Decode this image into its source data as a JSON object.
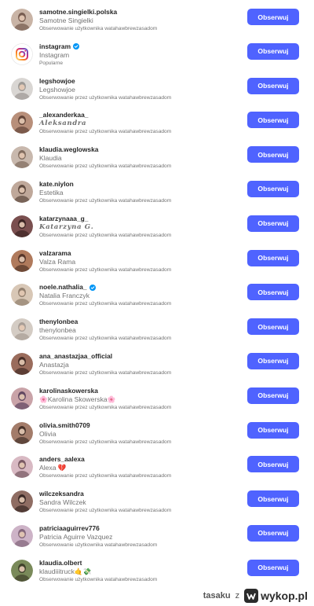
{
  "follow_label": "Obserwuj",
  "accent_color": "#4f63ff",
  "accounts": [
    {
      "username": "samotne.singielki.polska",
      "verified": false,
      "full_name": "Samotne Singielki",
      "subtitle": "Obserwowanie użytkownika watahawbrewzasadom",
      "avatar": "profile-photo"
    },
    {
      "username": "instagram",
      "verified": true,
      "full_name": "Instagram",
      "subtitle": "Popularne",
      "avatar": "instagram-logo"
    },
    {
      "username": "legshowjoe",
      "verified": false,
      "full_name": "Legshowjoe",
      "subtitle": "Obserwowanie przez użytkownika watahawbrewzasadom",
      "avatar": "profile-photo"
    },
    {
      "username": "_alexanderkaa_",
      "verified": false,
      "full_name": "𝑨𝒍𝒆𝒌𝒔𝒂𝒏𝒅𝒓𝒂",
      "subtitle": "Obserwowanie przez użytkownika watahawbrewzasadom",
      "avatar": "profile-photo",
      "script": true
    },
    {
      "username": "klaudia.weglowska",
      "verified": false,
      "full_name": "Klaudia",
      "subtitle": "Obserwowanie przez użytkownika watahawbrewzasadom",
      "avatar": "profile-photo"
    },
    {
      "username": "kate.niylon",
      "verified": false,
      "full_name": "Estetika",
      "subtitle": "Obserwowanie przez użytkownika watahawbrewzasadom",
      "avatar": "profile-photo"
    },
    {
      "username": "katarzynaaa_g_",
      "verified": false,
      "full_name": "𝑲𝒂𝒕𝒂𝒓𝒛𝒚𝒏𝒂 𝑮.",
      "subtitle": "Obserwowanie przez użytkownika watahawbrewzasadom",
      "avatar": "profile-photo",
      "script": true
    },
    {
      "username": "valzarama",
      "verified": false,
      "full_name": "Valza Rama",
      "subtitle": "Obserwowanie przez użytkownika watahawbrewzasadom",
      "avatar": "profile-photo"
    },
    {
      "username": "noele.nathalia_",
      "verified": true,
      "full_name": "Natalia Franczyk",
      "subtitle": "Obserwowanie przez użytkownika watahawbrewzasadom",
      "avatar": "profile-photo"
    },
    {
      "username": "thenylonbea",
      "verified": false,
      "full_name": "thenylonbea",
      "subtitle": "Obserwowanie przez użytkownika watahawbrewzasadom",
      "avatar": "profile-photo"
    },
    {
      "username": "ana_anastazjaa_official",
      "verified": false,
      "full_name": "Anastazja",
      "subtitle": "Obserwowanie przez użytkownika watahawbrewzasadom",
      "avatar": "profile-photo"
    },
    {
      "username": "karolinaskowerska",
      "verified": false,
      "full_name": "🌸Karolina Skowerska🌸",
      "subtitle": "Obserwowanie przez użytkownika watahawbrewzasadom",
      "avatar": "profile-photo"
    },
    {
      "username": "olivia.smith0709",
      "verified": false,
      "full_name": "Olivia",
      "subtitle": "Obserwowanie przez użytkownika watahawbrewzasadom",
      "avatar": "profile-photo"
    },
    {
      "username": "anders_aalexa",
      "verified": false,
      "full_name": "Alexa 💔",
      "subtitle": "Obserwowanie przez użytkownika watahawbrewzasadom",
      "avatar": "profile-photo"
    },
    {
      "username": "wilczeksandra",
      "verified": false,
      "full_name": "Sandra Wilczek",
      "subtitle": "Obserwowanie przez użytkownika watahawbrewzasadom",
      "avatar": "profile-photo"
    },
    {
      "username": "patriciaaguirrev776",
      "verified": false,
      "full_name": "Patricia Aguirre Vazquez",
      "subtitle": "Obserwowanie użytkownika watahawbrewzasadom",
      "avatar": "profile-photo"
    },
    {
      "username": "klaudia.olbert",
      "verified": false,
      "full_name": "klaudiiitruck🤙💸",
      "subtitle": "Obserwowanie użytkownika watahawbrewzasadom",
      "avatar": "profile-photo"
    }
  ],
  "footer": {
    "author": "tasaku",
    "preposition": "z",
    "site": "wykop.pl"
  }
}
